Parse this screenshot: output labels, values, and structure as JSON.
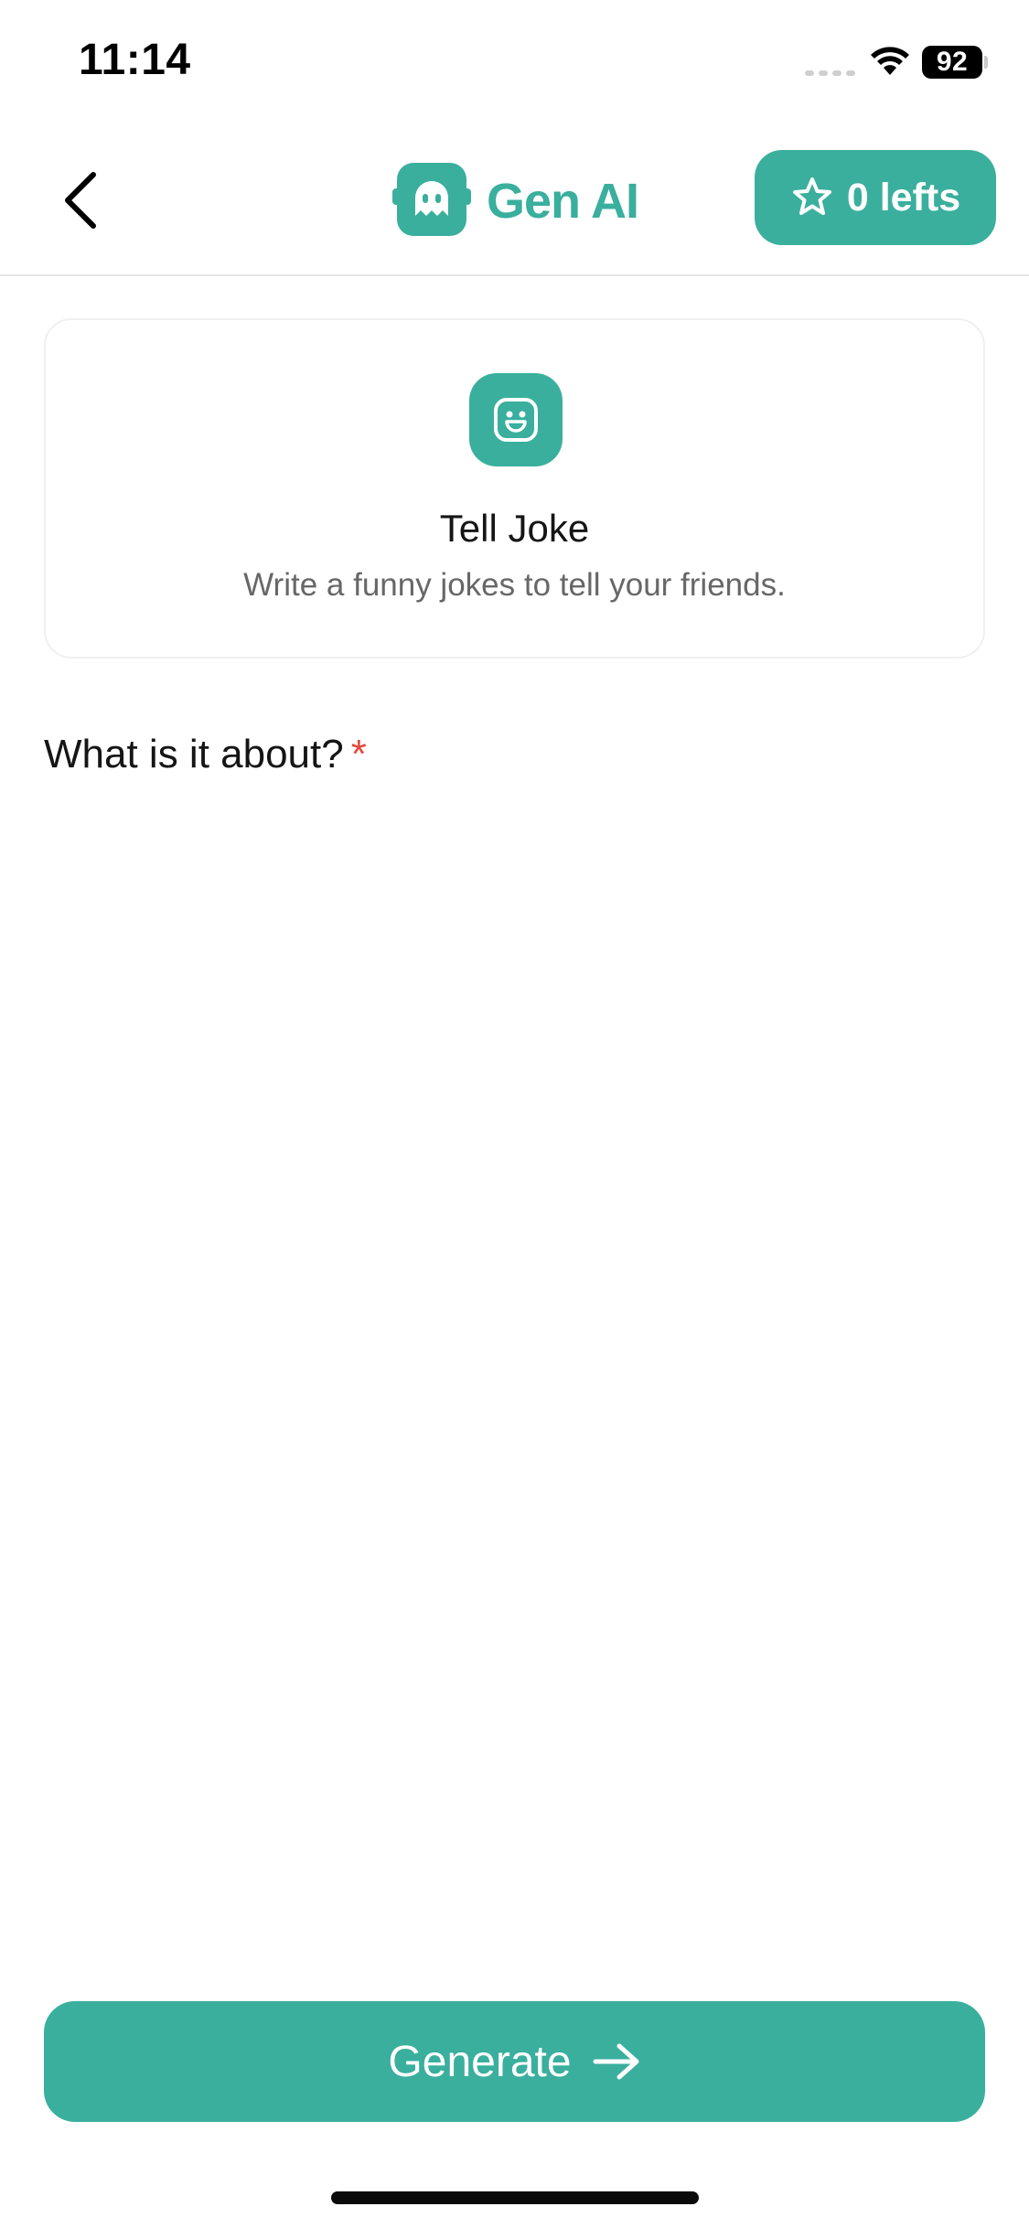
{
  "status_bar": {
    "time": "11:14",
    "battery_level": "92",
    "icons": [
      "signal-icon",
      "wifi-icon",
      "battery-icon"
    ]
  },
  "header": {
    "back_icon": "chevron-left-icon",
    "brand_name": "Gen AI",
    "brand_logo_icon": "robot-icon",
    "credits_label": "0 lefts",
    "credits_icon": "star-icon"
  },
  "tool_card": {
    "icon": "smile-face-icon",
    "title": "Tell Joke",
    "subtitle": "Write a funny jokes to tell your friends."
  },
  "form": {
    "question": "What is it about?",
    "required_marker": "*",
    "answer_value": "",
    "answer_placeholder": ""
  },
  "actions": {
    "generate_label": "Generate",
    "generate_icon": "arrow-right-icon"
  },
  "colors": {
    "accent": "#3aaf9d",
    "required": "#e5483c",
    "subtitle_text": "#676767"
  }
}
